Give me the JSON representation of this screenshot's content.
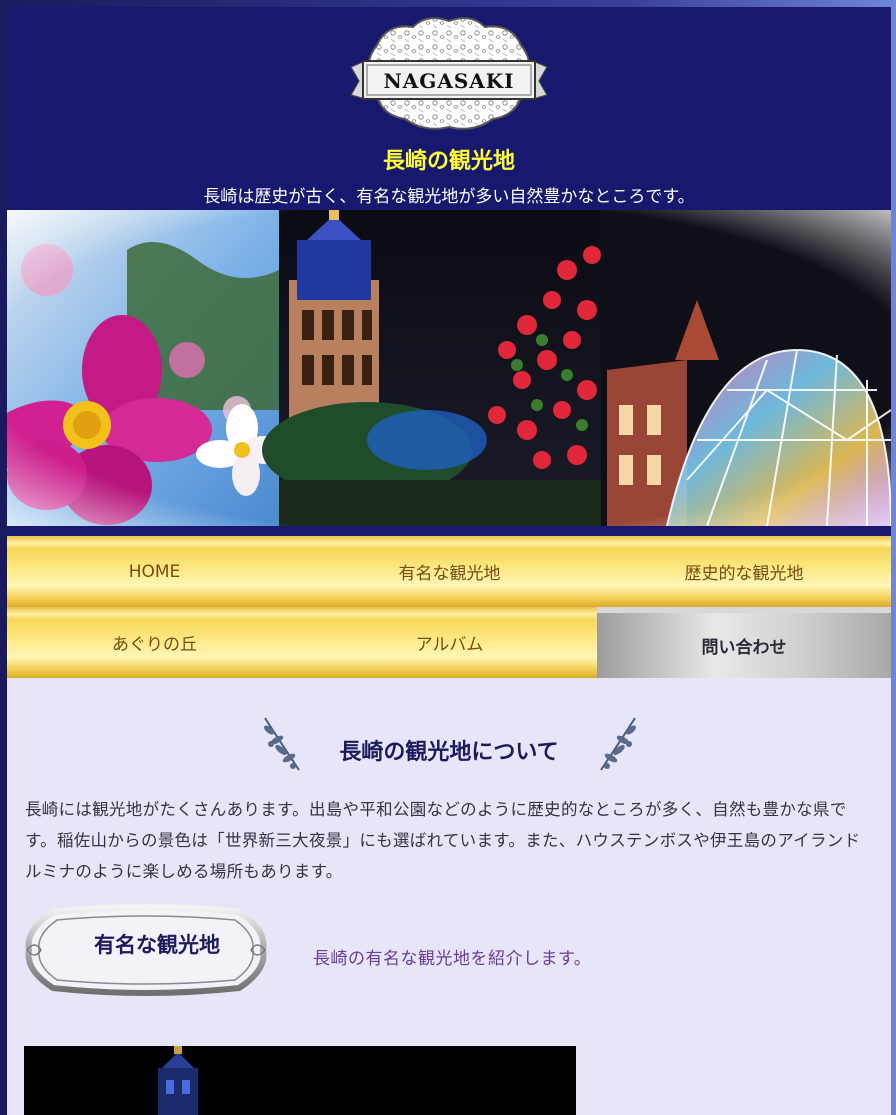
{
  "header": {
    "logo_text": "NAGASAKI",
    "title": "長崎の観光地",
    "subtitle": "長崎は歴史が古く、有名な観光地が多い自然豊かなところです。"
  },
  "nav": {
    "items": [
      {
        "label": "HOME"
      },
      {
        "label": "有名な観光地"
      },
      {
        "label": "歴史的な観光地"
      },
      {
        "label": "あぐりの丘"
      },
      {
        "label": "アルバム"
      },
      {
        "label": "問い合わせ"
      }
    ],
    "active_index": 5
  },
  "section": {
    "title": "長崎の観光地について",
    "intro": "長崎には観光地がたくさんあります。出島や平和公園などのように歴史的なところが多く、自然も豊かな県です。稲佐山からの景色は「世界新三大夜景」にも選ばれています。また、ハウステンボスや伊王島のアイランドルミナのように楽しめる場所もあります。"
  },
  "feature": {
    "badge_label": "有名な観光地",
    "description": "長崎の有名な観光地を紹介します。"
  },
  "colors": {
    "header_bg": "#17186e",
    "title_yellow": "#ffff33",
    "content_bg": "#e6e6f8",
    "nav_gold": "#fde982",
    "nav_text": "#7a4a12",
    "accent_purple": "#6b3b9a"
  }
}
